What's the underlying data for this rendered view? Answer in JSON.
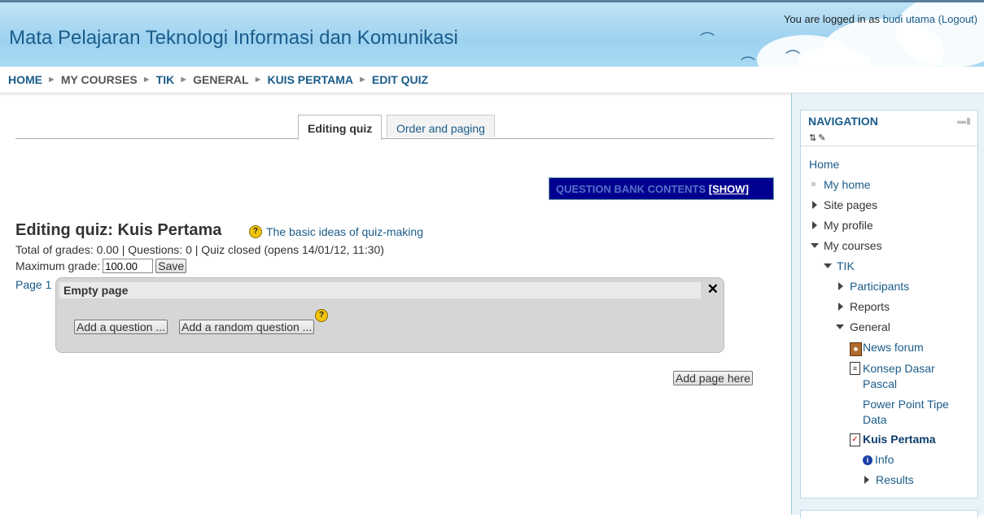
{
  "header": {
    "site_title": "Mata Pelajaran Teknologi Informasi dan Komunikasi",
    "login_prefix": "You are logged in as",
    "user_name": "budi utama",
    "logout_label": "(Logout)"
  },
  "breadcrumb": [
    "HOME",
    "MY COURSES",
    "TIK",
    "GENERAL",
    "KUIS PERTAMA",
    "EDIT QUIZ"
  ],
  "tabs": [
    {
      "label": "Editing quiz",
      "active": true
    },
    {
      "label": "Order and paging",
      "active": false
    }
  ],
  "question_bank": {
    "label": "QUESTION BANK CONTENTS",
    "show_label": "[SHOW]"
  },
  "quiz": {
    "heading": "Editing quiz: Kuis Pertama",
    "help_link": "The basic ideas of quiz-making",
    "stats": "Total of grades: 0.00 | Questions: 0 | Quiz closed (opens 14/01/12, 11:30)",
    "max_grade_label": "Maximum grade:",
    "max_grade_value": "100.00",
    "save_label": "Save"
  },
  "page": {
    "page_label": "Page 1",
    "title": "Empty page",
    "add_question_label": "Add a question ...",
    "add_random_label": "Add a random question ...",
    "add_page_label": "Add page here"
  },
  "navigation": {
    "title": "NAVIGATION",
    "items": {
      "home": "Home",
      "my_home": "My home",
      "site_pages": "Site pages",
      "my_profile": "My profile",
      "my_courses": "My courses",
      "tik": "TIK",
      "participants": "Participants",
      "reports": "Reports",
      "general": "General",
      "news_forum": "News forum",
      "konsep_1": "Konsep Dasar",
      "konsep_2": "Pascal",
      "ppt_1": "Power Point Tipe",
      "ppt_2": "Data",
      "kuis_pertama": "Kuis Pertama",
      "info": "Info",
      "results": "Results"
    }
  },
  "colors": {
    "accent": "#1a5c8a",
    "qbank_bg": "#000090"
  }
}
